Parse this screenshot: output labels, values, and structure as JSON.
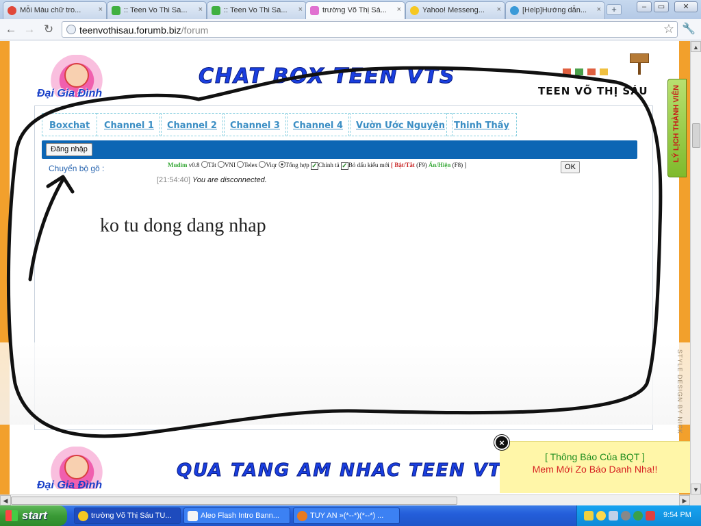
{
  "browser": {
    "tabs": [
      {
        "title": "Mỗi Màu chữ tro...",
        "icon": "chrome-red-icon",
        "active": false
      },
      {
        "title": ":: Teen Vo Thi Sa...",
        "icon": "speech-bubble-icon",
        "active": false
      },
      {
        "title": ":: Teen Vo Thi Sa...",
        "icon": "speech-bubble-icon",
        "active": false
      },
      {
        "title": "trường Võ Thị Sá...",
        "icon": "crown-icon",
        "active": true
      },
      {
        "title": "Yahoo! Messeng...",
        "icon": "yahoo-smiley-icon",
        "active": false
      },
      {
        "title": "[Help]Hướng dẫn...",
        "icon": "globe-icon",
        "active": false
      }
    ],
    "close_glyph": "×",
    "new_tab_glyph": "+",
    "url_host": "teenvothisau.forumb.biz",
    "url_path": "/forum",
    "nav": {
      "back": "←",
      "forward": "→",
      "reload": "↻",
      "star": "☆",
      "wrench": "🔧"
    },
    "window_buttons": {
      "minimize": "–",
      "maximize": "▭",
      "close": "✕"
    }
  },
  "page": {
    "logo_text": "Đại Gia Đình",
    "banner_title": "CHAT BOX TEEN VTS",
    "site_name": "TEEN VÕ THỊ SÁU",
    "profile_tab": "LÝ LỊCH THÀNH VIÊN",
    "styled_by": "STYLE DESIGN BY NICK",
    "chat": {
      "tabs": [
        "Boxchat",
        "Channel 1",
        "Channel 2",
        "Channel 3",
        "Channel 4",
        "Vườn Ước Nguyện",
        "Thinh Thấy"
      ],
      "login_button": "Đăng nhập",
      "converter_label": "Chuyển bộ gõ :",
      "ime": {
        "brand": "Mudim",
        "version": "v0.8",
        "options": [
          "Tắt",
          "VNI",
          "Telex",
          "Viqr",
          "Tổng hợp"
        ],
        "selected": "Tổng hợp",
        "spell_check": "Chính tả",
        "new_accent": "Bỏ dấu kiểu mới",
        "toggle": "[ Bật/Tắt",
        "toggle_key": "(F9)",
        "show_hide": "Ẩn/Hiện",
        "show_hide_key": "(F8) ]"
      },
      "ok_button": "OK",
      "status_time": "[21:54:40]",
      "status_message": "You are disconnected."
    },
    "footer_banner": "QUA TANG AM NHAC TEEN VTS",
    "notice": {
      "title": "[ Thông Báo Của BQT ]",
      "body": "Mem Mới Zo Báo Danh Nha!!",
      "close_glyph": "×"
    },
    "annotation": "ko tu dong  dang nhap"
  },
  "taskbar": {
    "start": "start",
    "tasks": [
      {
        "label": "trường Võ Thị Sáu TU...",
        "icon": "chrome-icon",
        "active": true
      },
      {
        "label": "Aleo Flash Intro Bann...",
        "icon": "aleo-icon",
        "active": false
      },
      {
        "label": "TUY AN »(*--*)(*--*) ...",
        "icon": "firefox-icon",
        "active": false
      }
    ],
    "clock": "9:54 PM"
  },
  "colors": {
    "page_accent": "#f2a02c",
    "chat_bar": "#0d66b4",
    "tab_link": "#3b8ec4",
    "banner_blue": "#1a3fe0",
    "notice_bg": "#fff6a8"
  }
}
